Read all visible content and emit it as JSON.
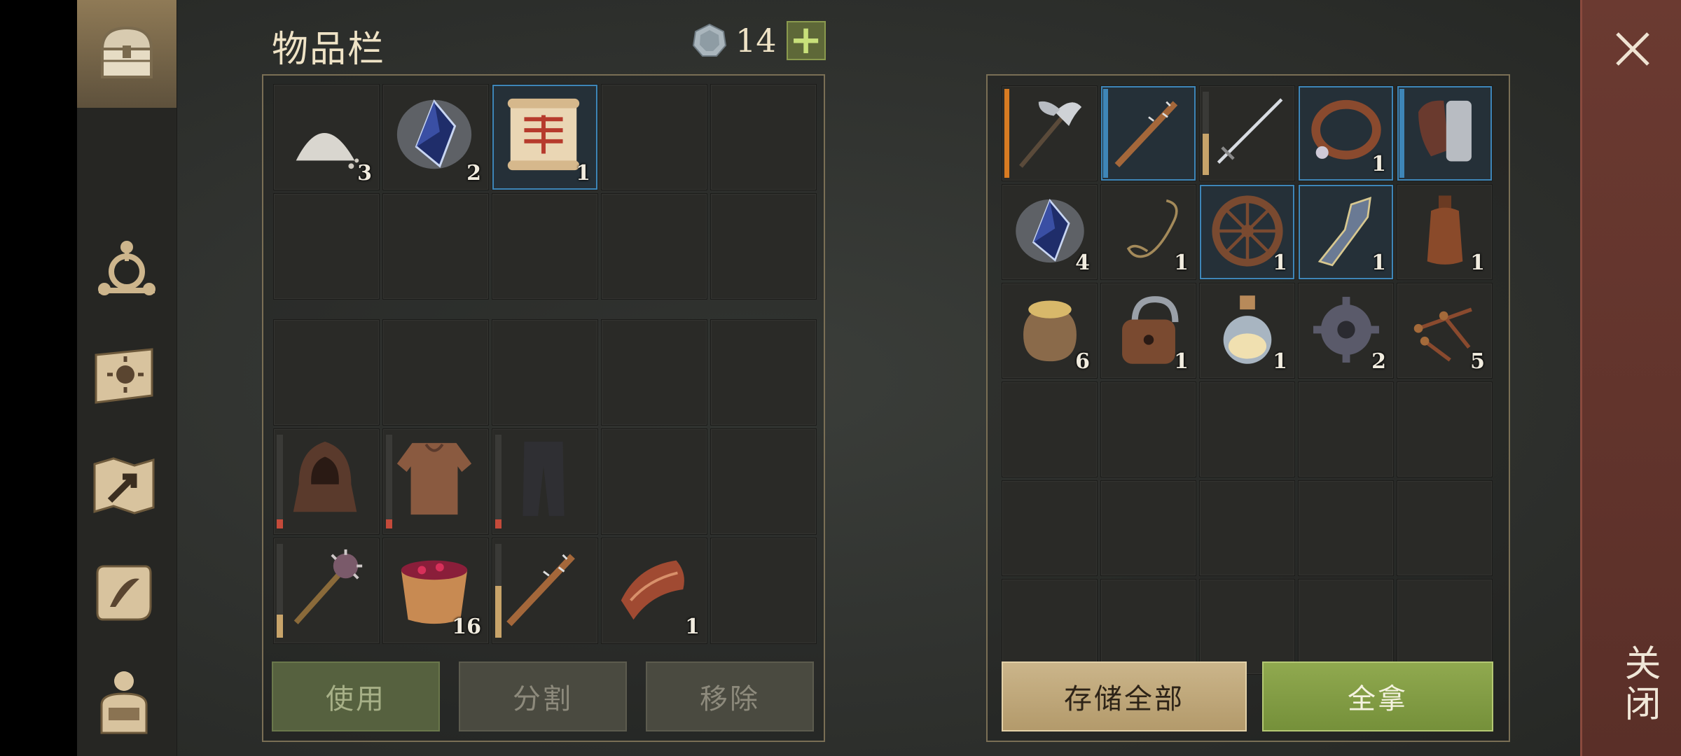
{
  "inventory": {
    "title": "物品栏",
    "coin_count": "14",
    "coin_icon": "silver-coin-icon",
    "plus_label": "+",
    "slots": [
      {
        "icon": "flour-pile-icon",
        "qty": "3"
      },
      {
        "icon": "crystal-icon",
        "qty": "2"
      },
      {
        "icon": "scroll-icon",
        "qty": "1",
        "rarity": "blue"
      },
      {
        "icon": "",
        "qty": ""
      },
      {
        "icon": "",
        "qty": ""
      },
      {
        "icon": "",
        "qty": ""
      },
      {
        "icon": "",
        "qty": ""
      },
      {
        "icon": "",
        "qty": ""
      },
      {
        "icon": "",
        "qty": ""
      },
      {
        "icon": "",
        "qty": ""
      }
    ],
    "equip_slots": [
      {
        "icon": "",
        "qty": ""
      },
      {
        "icon": "",
        "qty": ""
      },
      {
        "icon": "",
        "qty": ""
      },
      {
        "icon": "",
        "qty": ""
      },
      {
        "icon": "",
        "qty": ""
      },
      {
        "icon": "hood-icon",
        "qty": "",
        "durability": 0.1,
        "dur_color": "#c44a3a"
      },
      {
        "icon": "leather-armor-icon",
        "qty": "",
        "durability": 0.1,
        "dur_color": "#c44a3a"
      },
      {
        "icon": "pants-icon",
        "qty": "",
        "durability": 0.1,
        "dur_color": "#c44a3a"
      },
      {
        "icon": "",
        "qty": ""
      },
      {
        "icon": "",
        "qty": ""
      },
      {
        "icon": "mace-icon",
        "qty": "",
        "durability": 0.25,
        "dur_color": "#c8a46a"
      },
      {
        "icon": "berry-bowl-icon",
        "qty": "16"
      },
      {
        "icon": "spiked-club-icon",
        "qty": "",
        "durability": 0.55,
        "dur_color": "#c8a46a"
      },
      {
        "icon": "meat-strip-icon",
        "qty": "1"
      },
      {
        "icon": "",
        "qty": ""
      }
    ],
    "buttons": {
      "use": "使用",
      "split": "分割",
      "remove": "移除"
    }
  },
  "storage": {
    "slots": [
      {
        "icon": "battle-axe-icon",
        "qty": "",
        "rarity": "orange"
      },
      {
        "icon": "spiked-club-icon",
        "qty": "",
        "rarity": "blue"
      },
      {
        "icon": "sword-icon",
        "qty": "",
        "durability": 0.5,
        "dur_color": "#c8a46a"
      },
      {
        "icon": "collar-icon",
        "qty": "1",
        "rarity": "blue"
      },
      {
        "icon": "gauntlet-icon",
        "qty": "",
        "rarity": "blue"
      },
      {
        "icon": "crystal-icon",
        "qty": "4"
      },
      {
        "icon": "rope-icon",
        "qty": "1"
      },
      {
        "icon": "wheel-icon",
        "qty": "1",
        "rarity": "blue"
      },
      {
        "icon": "blade-fragment-icon",
        "qty": "1",
        "rarity": "blue"
      },
      {
        "icon": "bottle-icon",
        "qty": "1"
      },
      {
        "icon": "grain-sack-icon",
        "qty": "6"
      },
      {
        "icon": "padlock-icon",
        "qty": "1"
      },
      {
        "icon": "potion-icon",
        "qty": "1"
      },
      {
        "icon": "gear-part-icon",
        "qty": "2"
      },
      {
        "icon": "nails-icon",
        "qty": "5"
      },
      {
        "icon": "",
        "qty": ""
      },
      {
        "icon": "",
        "qty": ""
      },
      {
        "icon": "",
        "qty": ""
      },
      {
        "icon": "",
        "qty": ""
      },
      {
        "icon": "",
        "qty": ""
      },
      {
        "icon": "",
        "qty": ""
      },
      {
        "icon": "",
        "qty": ""
      },
      {
        "icon": "",
        "qty": ""
      },
      {
        "icon": "",
        "qty": ""
      },
      {
        "icon": "",
        "qty": ""
      },
      {
        "icon": "",
        "qty": ""
      },
      {
        "icon": "",
        "qty": ""
      },
      {
        "icon": "",
        "qty": ""
      },
      {
        "icon": "",
        "qty": ""
      },
      {
        "icon": "",
        "qty": ""
      }
    ],
    "buttons": {
      "store_all": "存储全部",
      "take_all": "全拿"
    }
  },
  "sidebar": {
    "items": [
      {
        "icon": "chest-icon",
        "active": true
      },
      {
        "icon": "crafting-icon"
      },
      {
        "icon": "sun-book-icon"
      },
      {
        "icon": "map-icon"
      },
      {
        "icon": "quest-scroll-icon"
      },
      {
        "icon": "character-icon"
      }
    ]
  },
  "close": {
    "label": "关闭",
    "icon": "close-icon"
  }
}
